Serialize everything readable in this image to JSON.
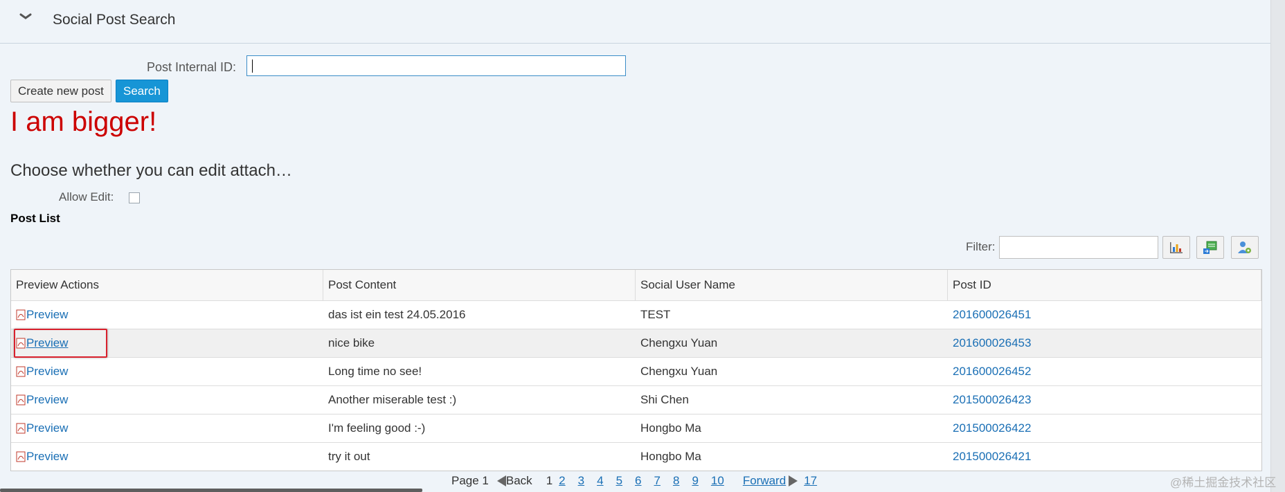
{
  "header": {
    "title": "Social Post Search",
    "collapse_icon": "chevron-down-icon"
  },
  "search": {
    "id_label": "Post Internal ID:",
    "id_value": "",
    "create_label": "Create new post",
    "search_label": "Search"
  },
  "banner": {
    "text": "I am bigger!",
    "color": "#cc0000"
  },
  "attach": {
    "title": "Choose whether you can edit attach…",
    "allow_label": "Allow Edit:",
    "allow_checked": false
  },
  "post_list": {
    "title": "Post List",
    "filter_label": "Filter:",
    "filter_value": "",
    "tools": [
      "bar-chart-icon",
      "export-icon",
      "user-settings-icon"
    ],
    "columns": [
      "Preview Actions",
      "Post Content",
      "Social User Name",
      "Post ID"
    ],
    "rows": [
      {
        "action": "Preview",
        "content": "das ist ein test 24.05.2016",
        "user": "TEST",
        "post_id": "201600026451"
      },
      {
        "action": "Preview",
        "content": "nice bike",
        "user": "Chengxu Yuan",
        "post_id": "201600026453"
      },
      {
        "action": "Preview",
        "content": "Long time no see!",
        "user": "Chengxu Yuan",
        "post_id": "201600026452"
      },
      {
        "action": "Preview",
        "content": "Another miserable test :)",
        "user": "Shi Chen",
        "post_id": "201500026423"
      },
      {
        "action": "Preview",
        "content": "I'm feeling good :-)",
        "user": "Hongbo Ma",
        "post_id": "201500026422"
      },
      {
        "action": "Preview",
        "content": "try it out",
        "user": "Hongbo Ma",
        "post_id": "201500026421"
      }
    ]
  },
  "pager": {
    "page_text": "Page 1",
    "back_label": "Back",
    "current": "1",
    "pages": [
      "2",
      "3",
      "4",
      "5",
      "6",
      "7",
      "8",
      "9",
      "10"
    ],
    "forward_label": "Forward",
    "last": "17"
  },
  "watermark": "@稀土掘金技术社区",
  "colors": {
    "accent": "#1795d6",
    "link": "#1a6fb5",
    "highlight": "#d9202c"
  }
}
